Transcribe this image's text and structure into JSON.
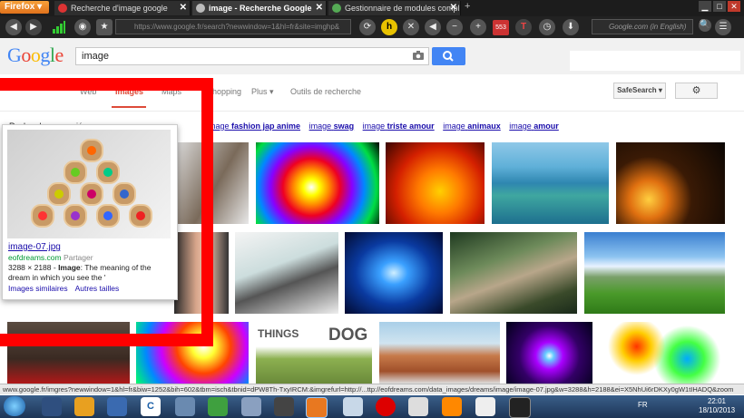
{
  "browser": {
    "menu_label": "Firefox",
    "tabs": [
      {
        "title": "Recherche d'image google"
      },
      {
        "title": "image - Recherche Google"
      },
      {
        "title": "Gestionnaire de modules complém..."
      }
    ],
    "new_tab": "+",
    "url": "https://www.google.fr/search?newwindow=1&hl=fr&site=imghp&",
    "search_placeholder": "Google.com (in English)",
    "badge_number": "553"
  },
  "google": {
    "logo": [
      "G",
      "o",
      "o",
      "g",
      "l",
      "e"
    ],
    "logo_colors": [
      "#4285f4",
      "#ea4335",
      "#fbbc05",
      "#4285f4",
      "#34a853",
      "#ea4335"
    ],
    "query": "image",
    "tabs": [
      {
        "label": "Web"
      },
      {
        "label": "Images"
      },
      {
        "label": "Maps"
      },
      {
        "label": "Shopping"
      },
      {
        "label": "Plus ▾"
      },
      {
        "label": "Outils de recherche"
      }
    ],
    "safesearch": "SafeSearch ▾",
    "related_prefix": "Recherches associées :",
    "related": [
      {
        "pre": "",
        "post": "fashion jap anime",
        "bold": "fashion jap anime",
        "full": "image fashion jap anime"
      },
      {
        "pre": "image",
        "post": " swag"
      },
      {
        "pre": "image",
        "post": " triste amour"
      },
      {
        "pre": "image",
        "post": " animaux"
      },
      {
        "pre": "image",
        "post": " amour"
      }
    ],
    "related_first": "fashion jap anime",
    "related_items": [
      "swag",
      "triste amour",
      "animaux",
      "amour"
    ],
    "related_word": "image"
  },
  "preview": {
    "title": "image-07.jpg",
    "source": "eofdreams.com",
    "share": "Partager",
    "desc_line1_prefix": "3288 × 2188 - ",
    "desc_bold": "Image",
    "desc_line1_suffix": ": The meaning of the",
    "desc_line2": "dream in which you see the '",
    "link_similar": "Images similaires",
    "link_sizes": "Autres tailles"
  },
  "statusbar": "www.google.fr/imgres?newwindow=1&hl=fr&biw=1252&bih=602&tbm=isch&tbnid=dPW8Th-TxyIRCM:&imgrefurl=http://...ttp://eofdreams.com/data_images/dreams/image/image-07.jpg&w=3288&h=2188&ei=X5NhUi6rDKXy0gW1tIHADQ&zoom",
  "taskbar": {
    "lang": "FR",
    "time": "22:01",
    "date": "18/10/2013"
  },
  "colors": {
    "accent_red": "#dd4b39",
    "frame_red": "#ff0000",
    "link_blue": "#1a0dab",
    "search_blue": "#4285f4"
  }
}
